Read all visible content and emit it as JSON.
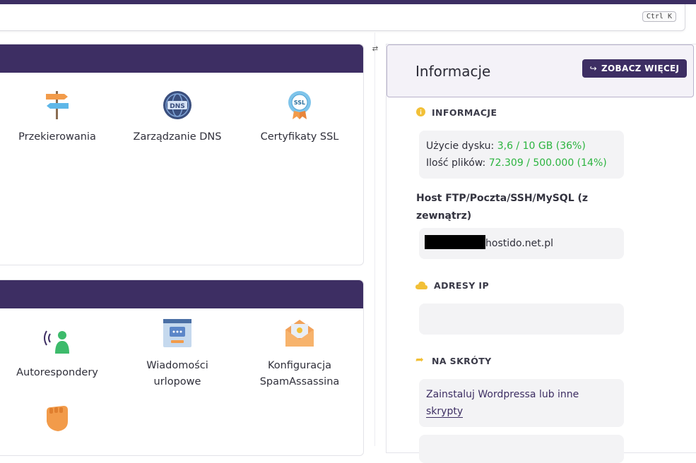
{
  "search": {
    "shortcut": "Ctrl K"
  },
  "email_tools": {
    "redirects_label": "Przekierowania",
    "dns_label": "Zarządzanie DNS",
    "ssl_label": "Certyfikaty SSL",
    "dns_icon_text": "DNS",
    "ssl_icon_text": "SSL"
  },
  "mail_tools": {
    "autoresponders_label": "Autorespondery",
    "vacation_line1": "Wiadomości",
    "vacation_line2": "urlopowe",
    "spam_line1": "Konfiguracja",
    "spam_line2": "SpamAssassina"
  },
  "panel": {
    "title": "Informacje",
    "more_button": "ZOBACZ WIĘCEJ",
    "info_heading": "INFORMACJE",
    "disk_label": "Użycie dysku:",
    "disk_value": "3,6 / 10 GB (36%)",
    "files_label": "Ilość plików:",
    "files_value": "72.309 / 500.000 (14%)",
    "host_label": "Host FTP/Poczta/SSH/MySQL (z zewnątrz)",
    "host_value": "hostido.net.pl",
    "ip_heading": "ADRESY IP",
    "shortcuts_heading": "NA SKRÓTY",
    "shortcut1_a": "Zainstaluj Wordpressa lub inne",
    "shortcut1_b": "skrypty"
  },
  "colors": {
    "brand": "#3d2e63",
    "accent_green": "#2bb43f",
    "info_yellow": "#f2c037"
  }
}
